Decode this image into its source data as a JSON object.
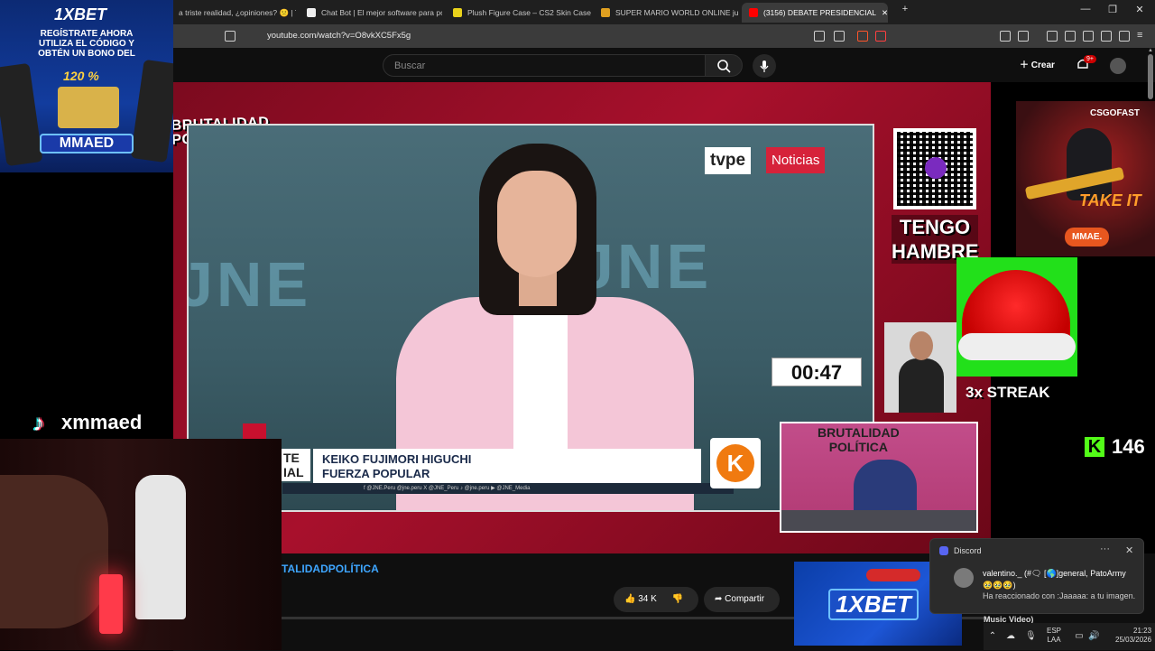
{
  "browser": {
    "tabs": [
      {
        "label": "a triste realidad, ¿opiniones? 😕 | Ti",
        "active": false
      },
      {
        "label": "Chat Bot | El mejor software para po",
        "active": false
      },
      {
        "label": "Plush Figure Case – CS2 Skin Case Op",
        "active": false
      },
      {
        "label": "SUPER MARIO WORLD ONLINE jueg",
        "active": false
      },
      {
        "label": "(3156) DEBATE PRESIDENCIAL",
        "active": true
      }
    ],
    "new_tab": "+",
    "window_controls": {
      "minimize": "—",
      "restore": "❐",
      "close": "✕"
    },
    "url": "youtube.com/watch?v=O8vkXC5Fx5g"
  },
  "youtube": {
    "search_placeholder": "Buscar",
    "create_label": "Crear",
    "notifications_badge": "9+",
    "hashtag": "TALIDADPOLÍTICA",
    "likes": "34 K",
    "share_label": "Compartir"
  },
  "stream": {
    "brand_top_left": "BRUTALIDAD\nPOLÍTICA",
    "video": {
      "watermark": "JNE",
      "channel_logo": "tvpe",
      "channel_name": "Noticias",
      "candidate_name": "KEIKO FUJIMORI HIGUCHI",
      "candidate_party": "FUERZA POPULAR",
      "party_logo": "K",
      "side_tag": "TE\nIAL",
      "social_strip": "f @JNE.Peru   @jne.peru   X @JNE_Peru   ♪ @jne.peru   ▶ @JNE_Media"
    },
    "qr_caption": "TENGO HAMBRE",
    "timer": "00:47",
    "streak": "3x STREAK",
    "kick_count": "146",
    "inset_cam_title": "BRUTALIDAD\nPOLÍTICA",
    "csgo_ad": {
      "brand": "CSGOFAST",
      "headline": "TAKE IT",
      "code": "MMAE."
    }
  },
  "left_panel": {
    "ad": {
      "brand": "1XBET",
      "text": "REGÍSTRATE AHORA UTILIZA EL CÓDIGO Y OBTÉN UN BONO DEL",
      "percent": "120 %",
      "code": "MMAED"
    },
    "tiktok_handle": "xmmaed"
  },
  "bottom_ad": {
    "brand": "1XBET"
  },
  "discord_toast": {
    "app": "Discord",
    "more": "···",
    "close": "✕",
    "line1": "valentino._ (#🗨 [🌎]general, PatoArmy",
    "line2": "🥹🥹🥹)",
    "line3": "Ha reaccionado con :Jaaaaa: a tu imagen."
  },
  "music_video_label": "Music Video)",
  "tray": {
    "lang_top": "ESP",
    "lang_bottom": "LAA",
    "time": "21:23",
    "date": "25/03/2026"
  },
  "colors": {
    "stream_bg": "#a8102c",
    "yt_link": "#3ea6ff",
    "kick_green": "#53fc18",
    "discord_blurple": "#5865f2"
  }
}
